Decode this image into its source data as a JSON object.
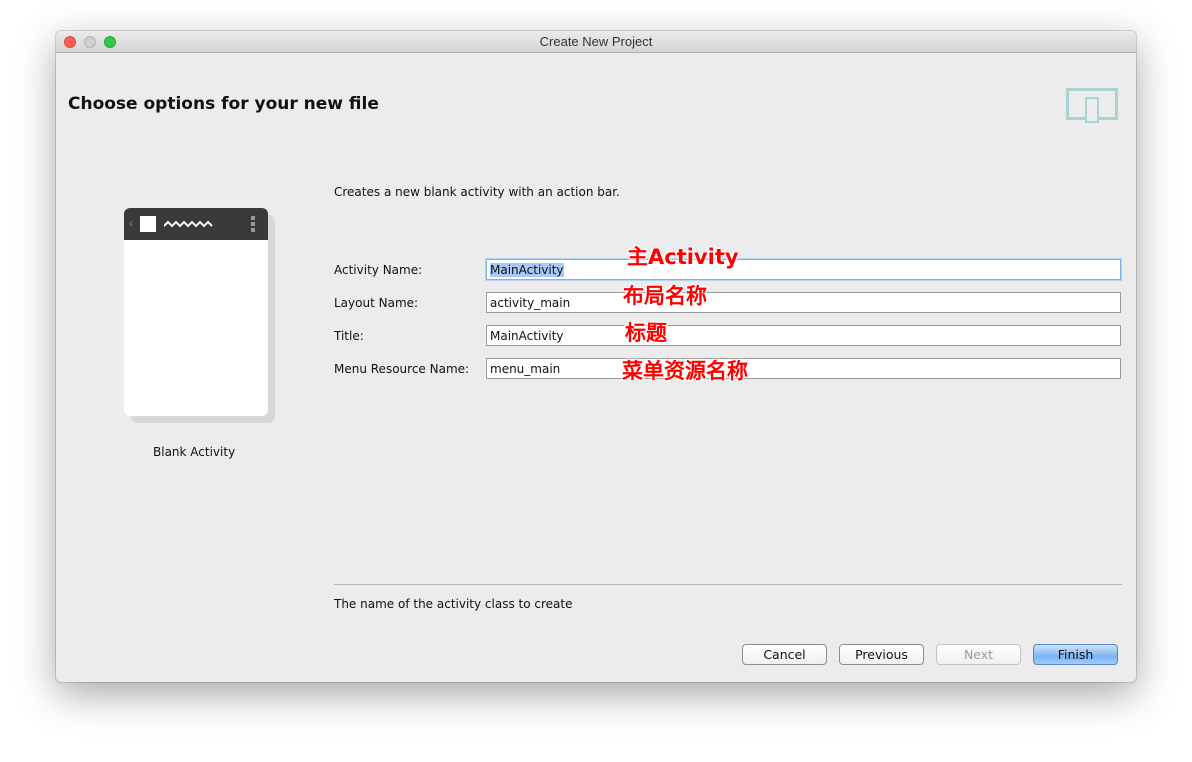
{
  "window": {
    "title": "Create New Project"
  },
  "header": {
    "title": "Choose options for your new file",
    "icon": "device-form-factor-icon"
  },
  "template": {
    "name": "Blank Activity"
  },
  "description": "Creates a new blank activity with an action bar.",
  "fields": [
    {
      "label": "Activity Name:",
      "value": "MainActivity",
      "annotation": "主Activity"
    },
    {
      "label": "Layout Name:",
      "value": "activity_main",
      "annotation": "布局名称"
    },
    {
      "label": "Title:",
      "value": "MainActivity",
      "annotation": "标题"
    },
    {
      "label": "Menu Resource Name:",
      "value": "menu_main",
      "annotation": "菜单资源名称"
    }
  ],
  "help_text": "The name of the activity class to create",
  "buttons": {
    "cancel": "Cancel",
    "previous": "Previous",
    "next": "Next",
    "finish": "Finish"
  },
  "colors": {
    "annotation": "#ff0000",
    "accent": "#7cb3f4",
    "icon": "#a9d3d2"
  }
}
